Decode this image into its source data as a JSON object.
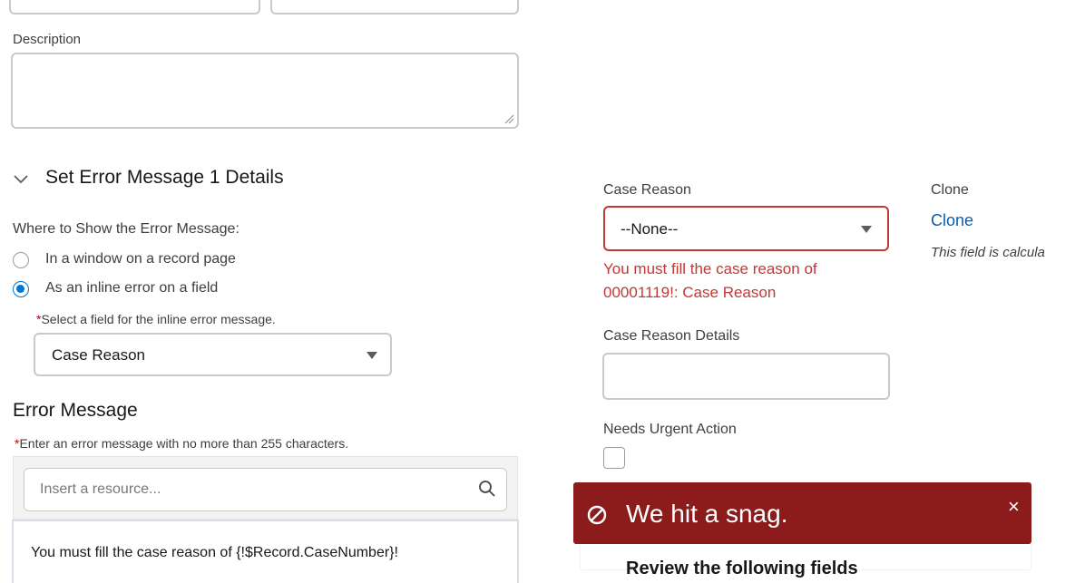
{
  "top_fields": {
    "left_value": "",
    "right_value": ""
  },
  "description": {
    "label": "Description",
    "value": ""
  },
  "section": {
    "title": "Set Error Message 1 Details"
  },
  "where_to_show": {
    "label": "Where to Show the Error Message:",
    "options": [
      {
        "label": "In a window on a record page",
        "selected": false
      },
      {
        "label": "As an inline error on a field",
        "selected": true
      }
    ]
  },
  "inline_field": {
    "required_mark": "*",
    "label": "Select a field for the inline error message.",
    "value": "Case Reason"
  },
  "error_message": {
    "title": "Error Message",
    "required_mark": "*",
    "hint": "Enter an error message with no more than 255 characters.",
    "resource_placeholder": "Insert a resource...",
    "text": "You must fill the case reason of {!$Record.CaseNumber}!"
  },
  "preview": {
    "case_reason_label": "Case Reason",
    "case_reason_value": "--None--",
    "case_reason_error_line1": "You must fill the case reason of",
    "case_reason_error_line2": "00001119!: Case Reason",
    "case_reason_details_label": "Case Reason Details",
    "case_reason_details_value": "",
    "needs_urgent_label": "Needs Urgent Action",
    "needs_urgent_checked": false,
    "clone_label": "Clone",
    "clone_link": "Clone",
    "clone_note": "This field is calcula"
  },
  "toast": {
    "title": "We hit a snag.",
    "close": "×",
    "body_partial": "Review the following fields"
  },
  "colors": {
    "error_red": "#c23934",
    "toast_bg": "#8c1c1c",
    "link_blue": "#0b5cab",
    "radio_blue": "#0176d3"
  }
}
